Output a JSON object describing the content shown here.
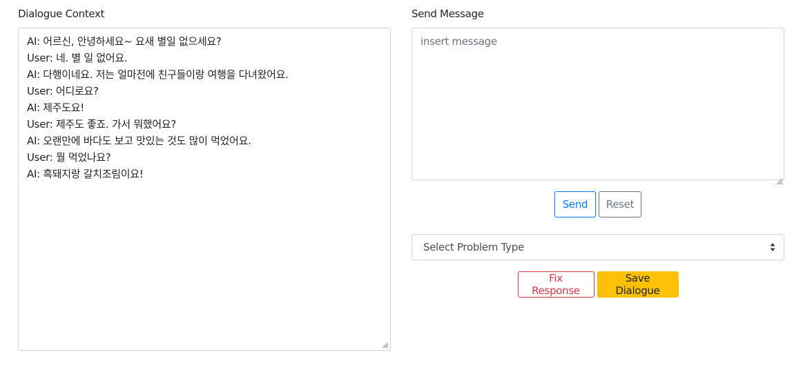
{
  "dialogue_context": {
    "label": "Dialogue Context",
    "lines": [
      "AI: 어르신, 안녕하세요~ 요새 별일 없으세요?",
      "User: 네. 별 일 없어요.",
      "AI: 다행이네요. 저는 얼마전에 친구들이랑 여행을 다녀왔어요.",
      "User: 어디로요?",
      "AI: 제주도요!",
      "User: 제주도 좋죠. 가서 뭐했어요?",
      "AI: 오랜만에 바다도 보고 맛있는 것도 많이 먹었어요.",
      "User: 뭘 먹었나요?",
      "AI: 흑돼지랑 갈치조림이요!"
    ]
  },
  "send_message": {
    "label": "Send Message",
    "placeholder": "insert message",
    "value": "",
    "send_label": "Send",
    "reset_label": "Reset"
  },
  "problem_type": {
    "selected": "Select Problem Type"
  },
  "actions": {
    "fix_label": "Fix Response",
    "save_label": "Save Dialogue"
  },
  "colors": {
    "primary": "#007bff",
    "secondary": "#6c757d",
    "danger": "#dc3545",
    "warning": "#ffc107",
    "border": "#ced4da"
  }
}
